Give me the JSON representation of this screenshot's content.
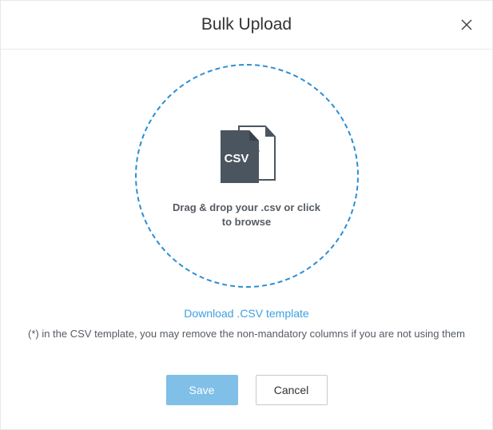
{
  "header": {
    "title": "Bulk Upload"
  },
  "dropzone": {
    "instruction": "Drag & drop your .csv or click to browse"
  },
  "template_link": {
    "label": "Download .CSV template"
  },
  "hint": {
    "text": "(*) in the CSV template, you may remove the non-mandatory columns if you are not using them"
  },
  "buttons": {
    "save": "Save",
    "cancel": "Cancel"
  },
  "icons": {
    "csv_label": "CSV"
  }
}
